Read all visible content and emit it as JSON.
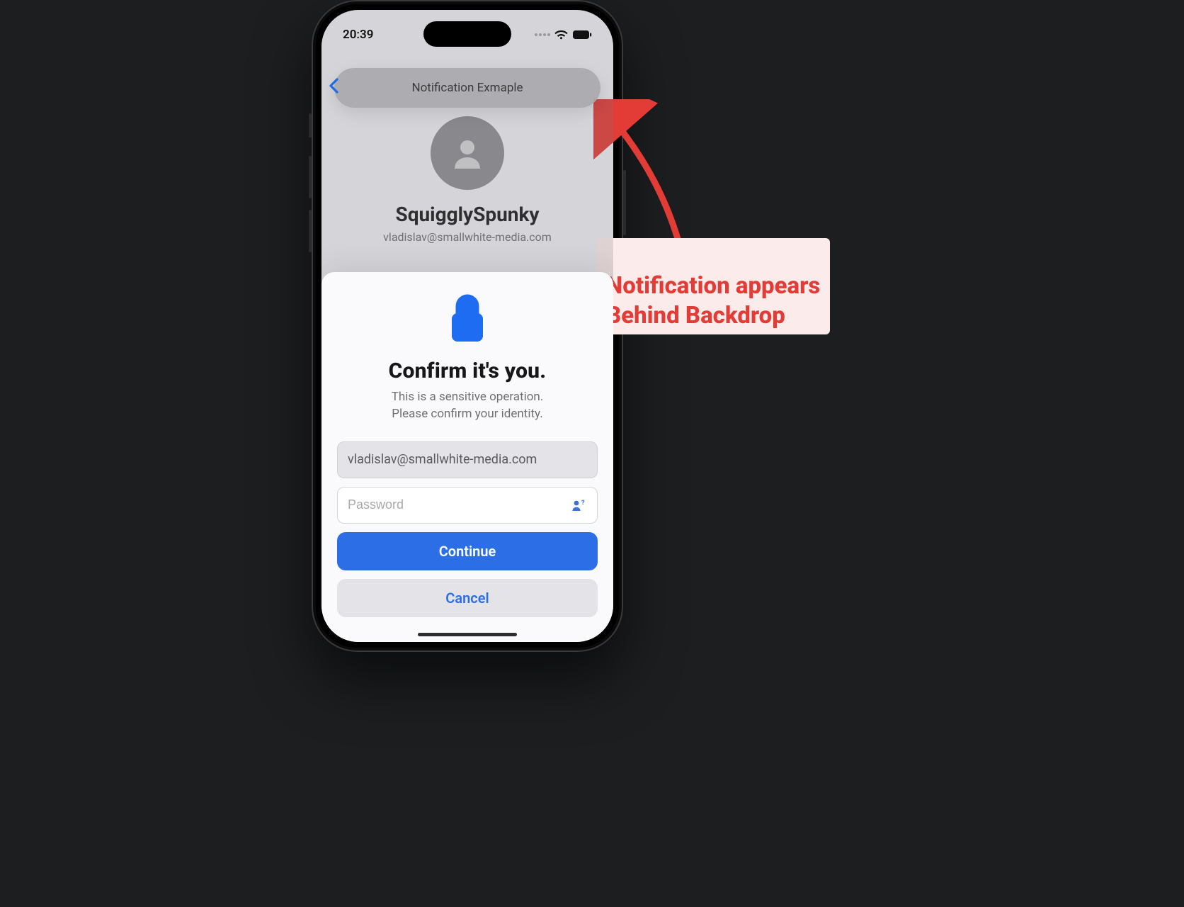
{
  "status": {
    "time": "20:39"
  },
  "notification": {
    "label": "Notification Exmaple"
  },
  "profile": {
    "username": "SquigglySpunky",
    "email": "vladislav@smallwhite-media.com"
  },
  "sheet": {
    "title": "Confirm it's you.",
    "sub1": "This is a sensitive operation.",
    "sub2": "Please confirm your identity.",
    "email_value": "vladislav@smallwhite-media.com",
    "password_placeholder": "Password",
    "continue_label": "Continue",
    "cancel_label": "Cancel"
  },
  "annotation": {
    "text": "Notification appears\nBehind Backdrop",
    "color": "#e33b36"
  }
}
